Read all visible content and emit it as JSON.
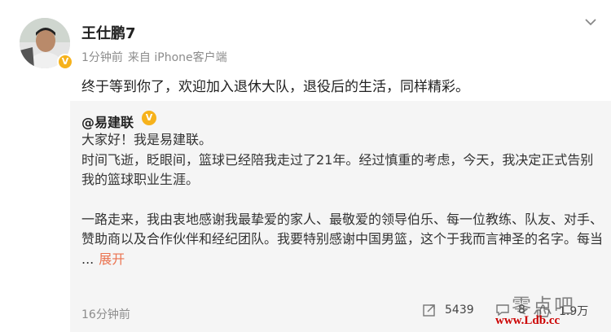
{
  "post": {
    "author": "王仕鹏7",
    "time": "1分钟前",
    "source": "来自 iPhone客户端",
    "text": "终于等到你了，欢迎加入退休大队，退役后的生活，同样精彩。"
  },
  "repost": {
    "author": "@易建联",
    "paragraph1": "大家好！我是易建联。",
    "paragraph2": "时间飞逝，眨眼间，篮球已经陪我走过了21年。经过慎重的考虑，今天，我决定正式告别我的篮球职业生涯。",
    "paragraph3": "一路走来，我由衷地感谢我最挚爱的家人、最敬爱的领导伯乐、每一位教练、队友、对手、赞助商以及合作伙伴和经纪团队。我要特别感谢中国男篮，这个于我而言神圣的名字。每当",
    "ellipsis": "...",
    "expand_label": "展开",
    "time": "16分钟前",
    "reposts": "5439",
    "comments": "8",
    "likes": "1.9万"
  },
  "watermark": {
    "text": "零点吧",
    "url": "www.Ldb.cc"
  },
  "colors": {
    "accent": "#eb7350",
    "verify": "#f6b21b",
    "repost_bg": "#f5f5f5"
  }
}
